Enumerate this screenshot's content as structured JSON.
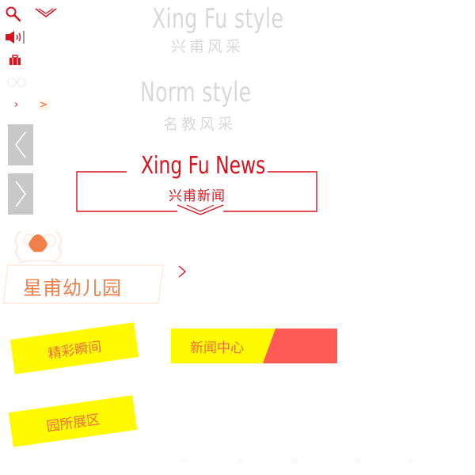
{
  "toolbar": {
    "search_icon": "search-icon",
    "expand_icon": "chevron-down-icon",
    "sound_icon": "speaker-icon",
    "bag_icon": "briefcase-icon",
    "small_arrow_1": "›",
    "small_arrow_2": ">"
  },
  "style_section": {
    "title_en": "Xing Fu style",
    "title_cn": "兴甫风采"
  },
  "norm_section": {
    "title_en": "Norm style",
    "title_cn": "名教风采"
  },
  "news_section": {
    "title_en": "Xing Fu News",
    "title_cn": "兴甫新闻"
  },
  "kindergarten": {
    "name": "星甫幼儿园",
    "more_arrow": "›"
  },
  "tags": {
    "moments": "精彩瞬间",
    "news_center": "新闻中心",
    "campus_display": "园所展区"
  },
  "colors": {
    "accent_red": "#d9141e",
    "accent_orange": "#f07f4a",
    "tag_yellow": "#fffa00",
    "tag_coral": "#ff5a55",
    "nav_gray": "#c8c8c8"
  }
}
